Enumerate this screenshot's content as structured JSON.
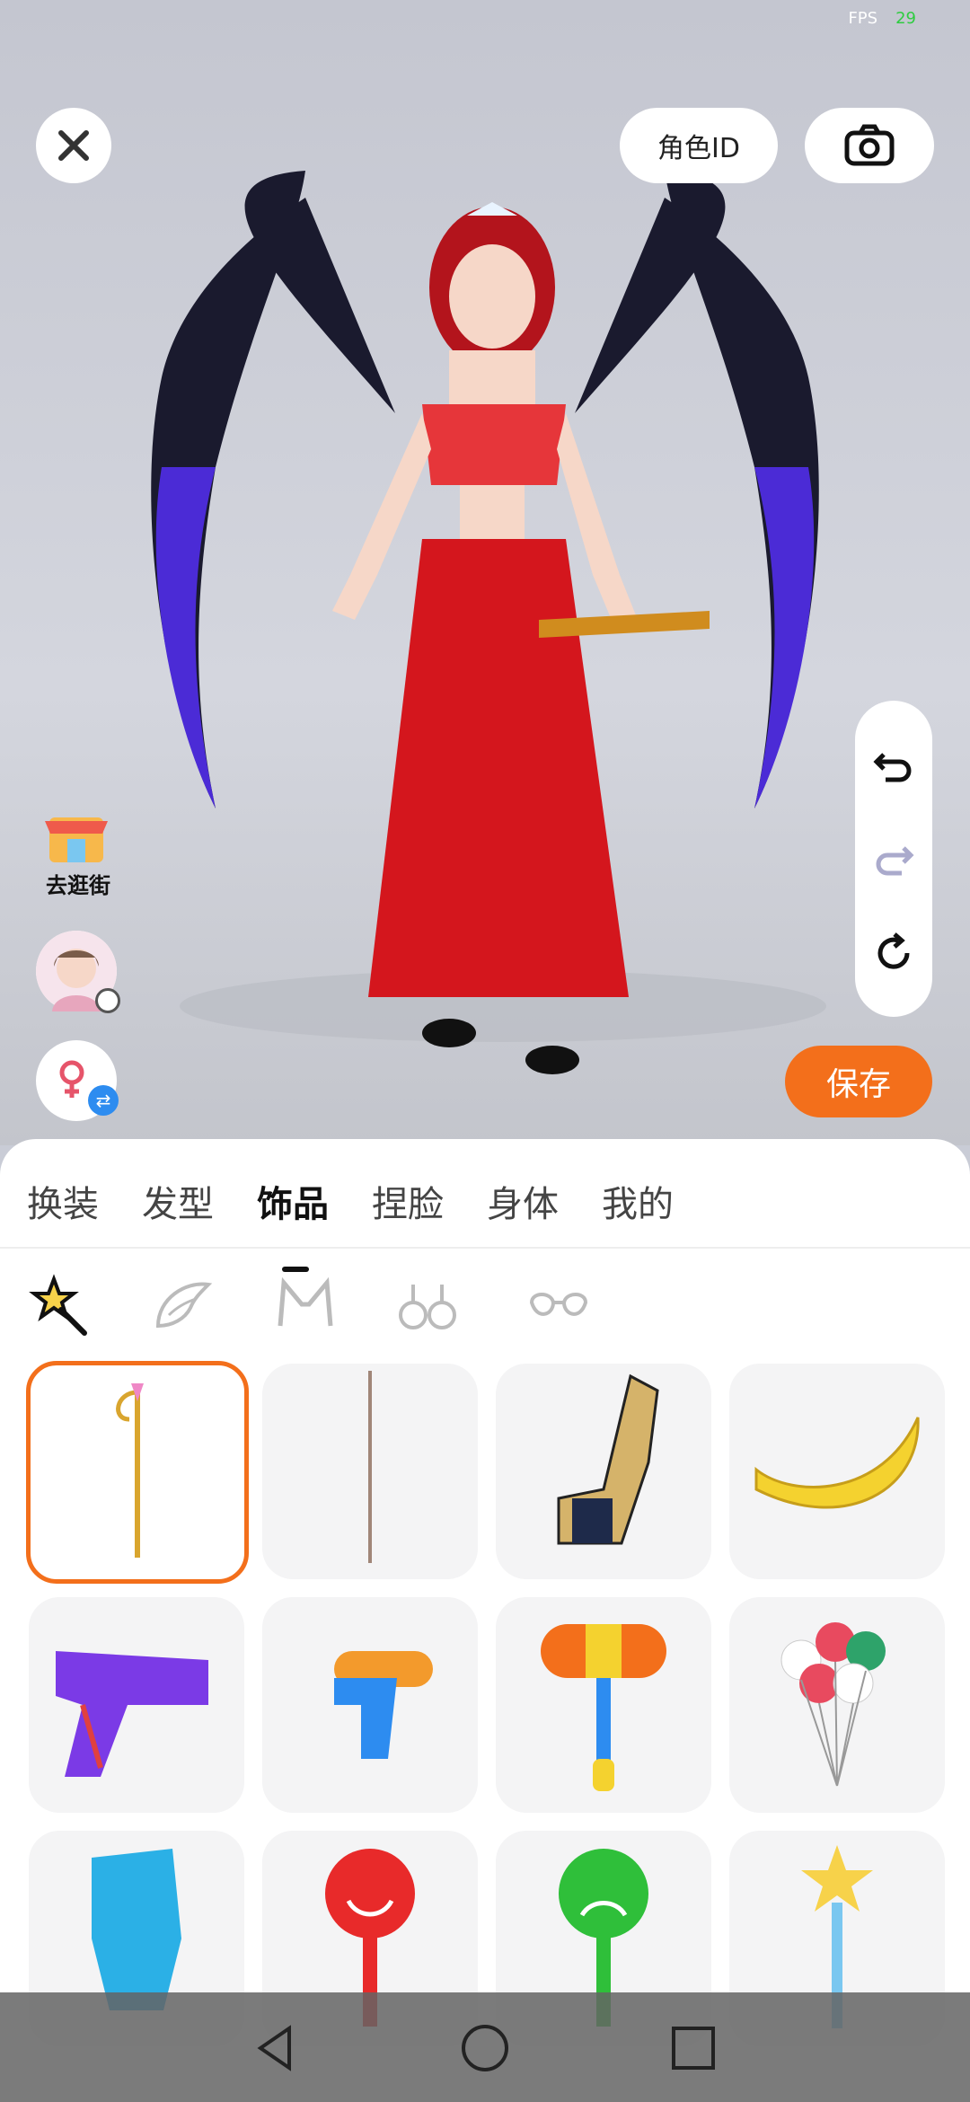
{
  "status": {
    "fps_label": "FPS",
    "fps_value": "29"
  },
  "header": {
    "role_id_label": "角色ID"
  },
  "side": {
    "shop_label": "去逛街"
  },
  "actions": {
    "save_label": "保存"
  },
  "tabs": [
    {
      "label": "换装",
      "active": false
    },
    {
      "label": "发型",
      "active": false
    },
    {
      "label": "饰品",
      "active": true
    },
    {
      "label": "捏脸",
      "active": false
    },
    {
      "label": "身体",
      "active": false
    },
    {
      "label": "我的",
      "active": false
    }
  ],
  "subcategories": [
    "wand-icon",
    "wing-icon",
    "ears-icon",
    "earrings-icon",
    "glasses-icon"
  ],
  "items": [
    {
      "name": "golden-staff",
      "selected": true
    },
    {
      "name": "beaded-wand",
      "selected": false
    },
    {
      "name": "gauntlet-blade",
      "selected": false
    },
    {
      "name": "banana",
      "selected": false
    },
    {
      "name": "purple-pistol",
      "selected": false
    },
    {
      "name": "water-gun",
      "selected": false
    },
    {
      "name": "toy-hammer",
      "selected": false
    },
    {
      "name": "balloons",
      "selected": false
    },
    {
      "name": "blue-glove",
      "selected": false
    },
    {
      "name": "smiley-sign",
      "selected": false
    },
    {
      "name": "sad-sign",
      "selected": false
    },
    {
      "name": "star-wand",
      "selected": false
    }
  ],
  "colors": {
    "accent": "#f36f1b",
    "fps_value": "#2ecc40"
  }
}
